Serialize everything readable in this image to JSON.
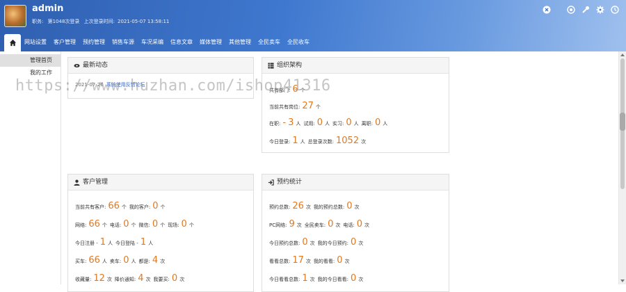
{
  "header": {
    "username": "admin",
    "role_label": "职务:",
    "login_count": "第1048次登录",
    "last_login_label": "上次登录时间:",
    "last_login_time": "2021-05-07 13:58:11"
  },
  "nav": {
    "items": [
      "网站设置",
      "客户管理",
      "预约管理",
      "销售车源",
      "车况采编",
      "信息文章",
      "媒体管理",
      "其他管理",
      "全民卖车",
      "全民收车"
    ]
  },
  "sidebar": {
    "items": [
      "管理首页",
      "我的工作"
    ]
  },
  "panels": {
    "news": {
      "title": "最新动态",
      "date": "2021-07-26",
      "link": "系统使用反馈论坛"
    },
    "org": {
      "title": "组织架构",
      "dept_label": "共有部门:",
      "dept_value": "6",
      "dept_unit": "个",
      "pos_label": "当前共有岗位:",
      "pos_value": "27",
      "pos_unit": "个",
      "incumbent_label": "在职:",
      "incumbent_value": "3",
      "probation_label": "试用:",
      "probation_value": "0",
      "intern_label": "实习:",
      "intern_value": "0",
      "resigned_label": "离职:",
      "resigned_value": "0",
      "person_unit": "人",
      "today_login_label": "今日登录:",
      "today_login_value": "1",
      "total_login_label": "总登录次数:",
      "total_login_value": "1052",
      "times_unit": "次"
    },
    "customers": {
      "title": "客户管理",
      "total_label": "当前共有客户:",
      "total_value": "66",
      "mine_label": "我的客户:",
      "mine_value": "0",
      "count_unit": "个",
      "web_label": "网络:",
      "web_value": "66",
      "phone_label": "电话:",
      "phone_value": "0",
      "wechat_label": "微信:",
      "wechat_value": "0",
      "site_label": "现场:",
      "site_value": "0",
      "today_reg_label": "今日注册 -",
      "today_reg_value": "1",
      "today_login_label": "今日登陆 -",
      "today_login_value": "1",
      "person_unit": "人",
      "buy_label": "买车:",
      "buy_value": "66",
      "sell_label": "卖车:",
      "sell_value": "0",
      "other_label": "都是:",
      "other_value": "4",
      "times_unit": "次",
      "fav_label": "收藏量:",
      "fav_value": "12",
      "price_label": "降价通知:",
      "price_value": "4",
      "want_label": "我要买:",
      "want_value": "0"
    },
    "booking": {
      "title": "预约统计",
      "total_label": "预约总数:",
      "total_value": "26",
      "mine_label": "我的预约总数:",
      "mine_value": "0",
      "times_unit": "次",
      "pc_label": "PC网络:",
      "pc_value": "9",
      "mobile_label": "全民卖车:",
      "mobile_value": "0",
      "phone_label": "电话:",
      "phone_value": "0",
      "today_label": "今日预约总数:",
      "today_value": "0",
      "my_today_label": "我的今日预约:",
      "my_today_value": "0",
      "view_total_label": "看看总数:",
      "view_total_value": "17",
      "my_view_label": "我的看看:",
      "my_view_value": "0",
      "today_view_label": "今日看看总数:",
      "today_view_value": "1",
      "my_today_view_label": "我的今日看看:",
      "my_today_view_value": "0"
    }
  },
  "watermark": "https://www.huzhan.com/ishop41316",
  "colors": {
    "header_blue": "#3f78cf",
    "accent_number": "#e07820",
    "link": "#3366cc"
  }
}
